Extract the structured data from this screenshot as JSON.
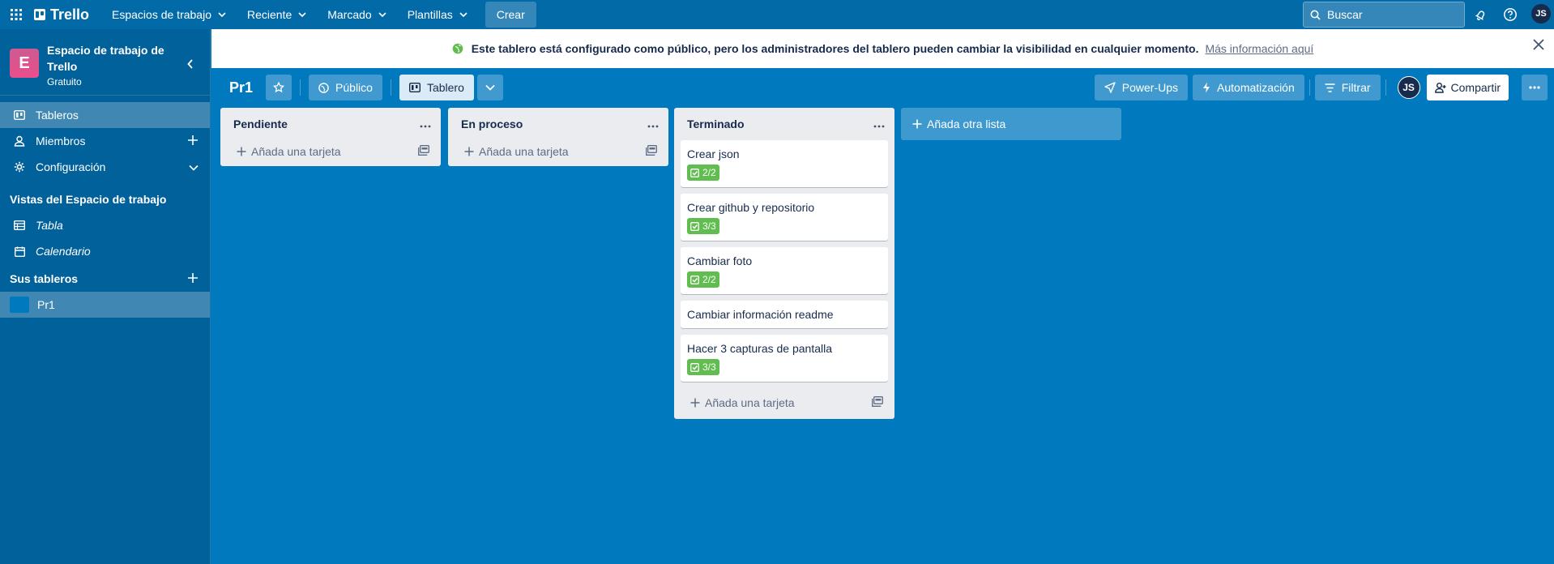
{
  "topbar": {
    "app_name": "Trello",
    "nav": [
      "Espacios de trabajo",
      "Reciente",
      "Marcado",
      "Plantillas"
    ],
    "create_label": "Crear",
    "search_placeholder": "Buscar",
    "user_initials": "JS"
  },
  "sidebar": {
    "workspace_name": "Espacio de trabajo de Trello",
    "workspace_initial": "E",
    "workspace_plan": "Gratuito",
    "items": [
      {
        "label": "Tableros"
      },
      {
        "label": "Miembros"
      },
      {
        "label": "Configuración"
      }
    ],
    "views_title": "Vistas del Espacio de trabajo",
    "views": [
      {
        "label": "Tabla"
      },
      {
        "label": "Calendario"
      }
    ],
    "boards_title": "Sus tableros",
    "boards": [
      {
        "label": "Pr1",
        "color": "#0079bf"
      }
    ]
  },
  "banner": {
    "message": "Este tablero está configurado como público, pero los administradores del tablero pueden cambiar la visibilidad en cualquier momento.",
    "link": "Más información aquí"
  },
  "board": {
    "title": "Pr1",
    "visibility": "Público",
    "view": "Tablero",
    "powerups": "Power-Ups",
    "automation": "Automatización",
    "filter": "Filtrar",
    "member_initials": "JS",
    "share": "Compartir"
  },
  "lists": [
    {
      "title": "Pendiente",
      "add_label": "Añada una tarjeta",
      "cards": []
    },
    {
      "title": "En proceso",
      "add_label": "Añada una tarjeta",
      "cards": []
    },
    {
      "title": "Terminado",
      "add_label": "Añada una tarjeta",
      "cards": [
        {
          "title": "Crear json",
          "checklist": "2/2"
        },
        {
          "title": "Crear github y repositorio",
          "checklist": "3/3"
        },
        {
          "title": "Cambiar foto",
          "checklist": "2/2"
        },
        {
          "title": "Cambiar información readme",
          "checklist": ""
        },
        {
          "title": "Hacer 3 capturas de pantalla",
          "checklist": "3/3"
        }
      ]
    }
  ],
  "add_list_label": "Añada otra lista",
  "colors": {
    "board_bg": "#0079bf",
    "topbar": "#026aa7",
    "sidebar": "#01619a",
    "checklist_complete": "#61bd4f",
    "workspace_logo": "#e94f8b"
  }
}
